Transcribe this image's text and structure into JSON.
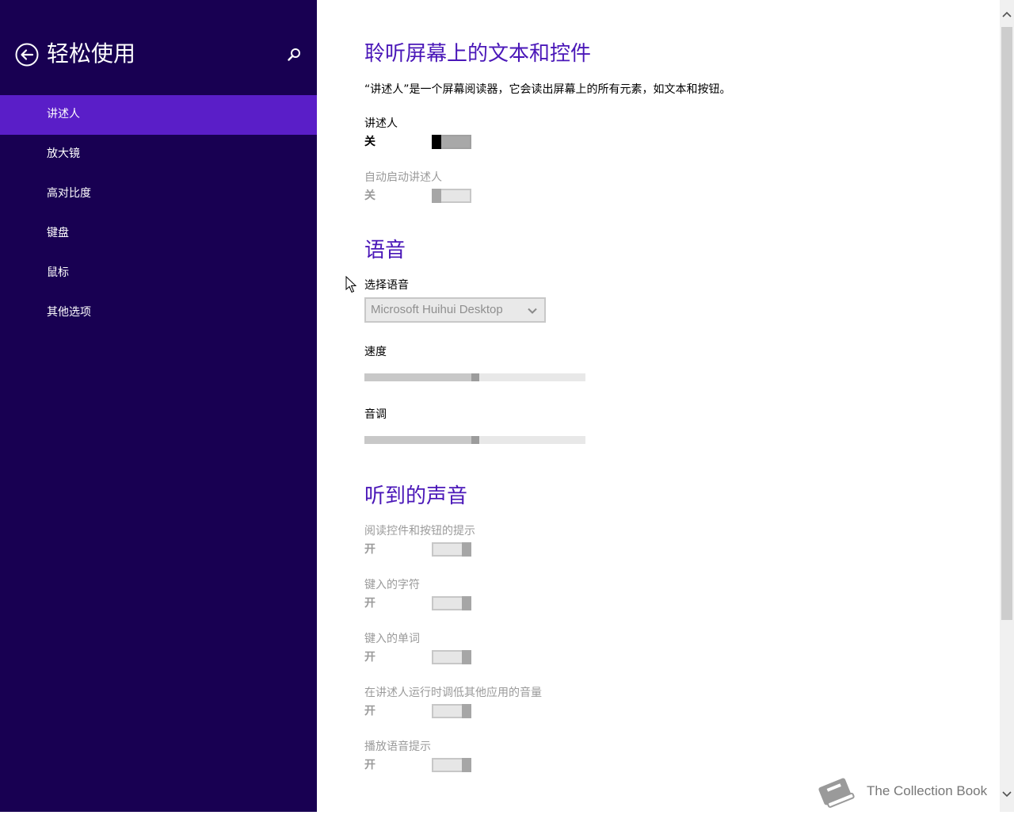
{
  "sidebar": {
    "title": "轻松使用",
    "items": [
      {
        "label": "讲述人",
        "selected": true
      },
      {
        "label": "放大镜"
      },
      {
        "label": "高对比度"
      },
      {
        "label": "键盘"
      },
      {
        "label": "鼠标"
      },
      {
        "label": "其他选项"
      }
    ]
  },
  "main": {
    "section1": {
      "heading": "聆听屏幕上的文本和控件",
      "description": "“讲述人”是一个屏幕阅读器，它会读出屏幕上的所有元素，如文本和按钮。",
      "narrator": {
        "label": "讲述人",
        "state": "关"
      },
      "auto_start": {
        "label": "自动启动讲述人",
        "state": "关"
      }
    },
    "section2": {
      "heading": "语音",
      "voice": {
        "label": "选择语音",
        "value": "Microsoft Huihui Desktop"
      },
      "speed": {
        "label": "速度",
        "level": 0.5
      },
      "pitch": {
        "label": "音调",
        "level": 0.5
      }
    },
    "section3": {
      "heading": "听到的声音",
      "toggles": [
        {
          "label": "阅读控件和按钮的提示",
          "state": "开"
        },
        {
          "label": "键入的字符",
          "state": "开"
        },
        {
          "label": "键入的单词",
          "state": "开"
        },
        {
          "label": "在讲述人运行时调低其他应用的音量",
          "state": "开"
        },
        {
          "label": "播放语音提示",
          "state": "开"
        }
      ]
    }
  },
  "watermark": {
    "text": "The Collection Book"
  },
  "icons": {
    "back": "back-arrow-icon",
    "search": "search-icon",
    "dropdown": "chevron-down-icon",
    "cursor": "mouse-pointer-icon",
    "watermark": "book-icon"
  },
  "colors": {
    "sidebar_bg": "#180052",
    "selected_item": "#5a1ec8",
    "heading": "#4a17b8"
  }
}
